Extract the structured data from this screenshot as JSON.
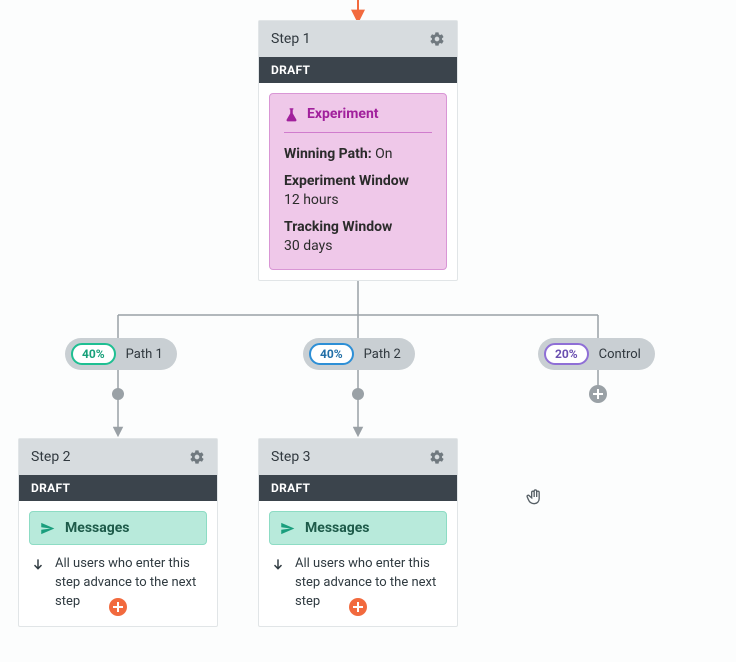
{
  "step1": {
    "title": "Step 1",
    "status": "DRAFT",
    "experiment": {
      "heading": "Experiment",
      "winning_path_label": "Winning Path:",
      "winning_path_value": "On",
      "exp_window_label": "Experiment Window",
      "exp_window_value": "12 hours",
      "track_window_label": "Tracking Window",
      "track_window_value": "30 days"
    }
  },
  "paths": {
    "p1": {
      "pct": "40%",
      "label": "Path 1"
    },
    "p2": {
      "pct": "40%",
      "label": "Path 2"
    },
    "control": {
      "pct": "20%",
      "label": "Control"
    }
  },
  "step2": {
    "title": "Step 2",
    "status": "DRAFT",
    "messages_label": "Messages",
    "desc": "All users who enter this step advance to the next step"
  },
  "step3": {
    "title": "Step 3",
    "status": "DRAFT",
    "messages_label": "Messages",
    "desc": "All users who enter this step advance to the next step"
  }
}
